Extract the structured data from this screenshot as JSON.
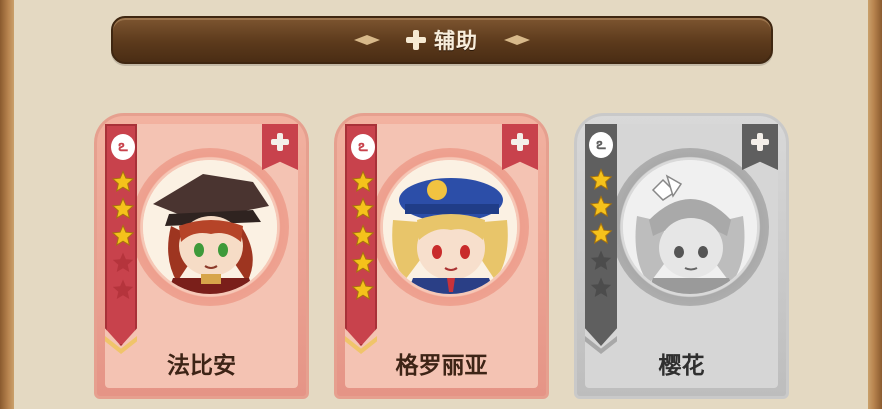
{
  "header": {
    "title": "辅助",
    "icon": "plus-icon"
  },
  "cards": [
    {
      "name": "法比安",
      "theme": "red",
      "element_icon": "flame-icon",
      "stars": 3,
      "max_stars": 5,
      "add_icon": "plus-icon"
    },
    {
      "name": "格罗丽亚",
      "theme": "red",
      "element_icon": "flame-icon",
      "stars": 5,
      "max_stars": 5,
      "add_icon": "plus-icon"
    },
    {
      "name": "樱花",
      "theme": "gray",
      "element_icon": "flame-icon",
      "stars": 3,
      "max_stars": 5,
      "add_icon": "plus-icon"
    }
  ],
  "colors": {
    "active": "#c8424c",
    "inactive": "#5f5f5f",
    "star": "#f5c21b",
    "header": "#5c3a1c"
  }
}
